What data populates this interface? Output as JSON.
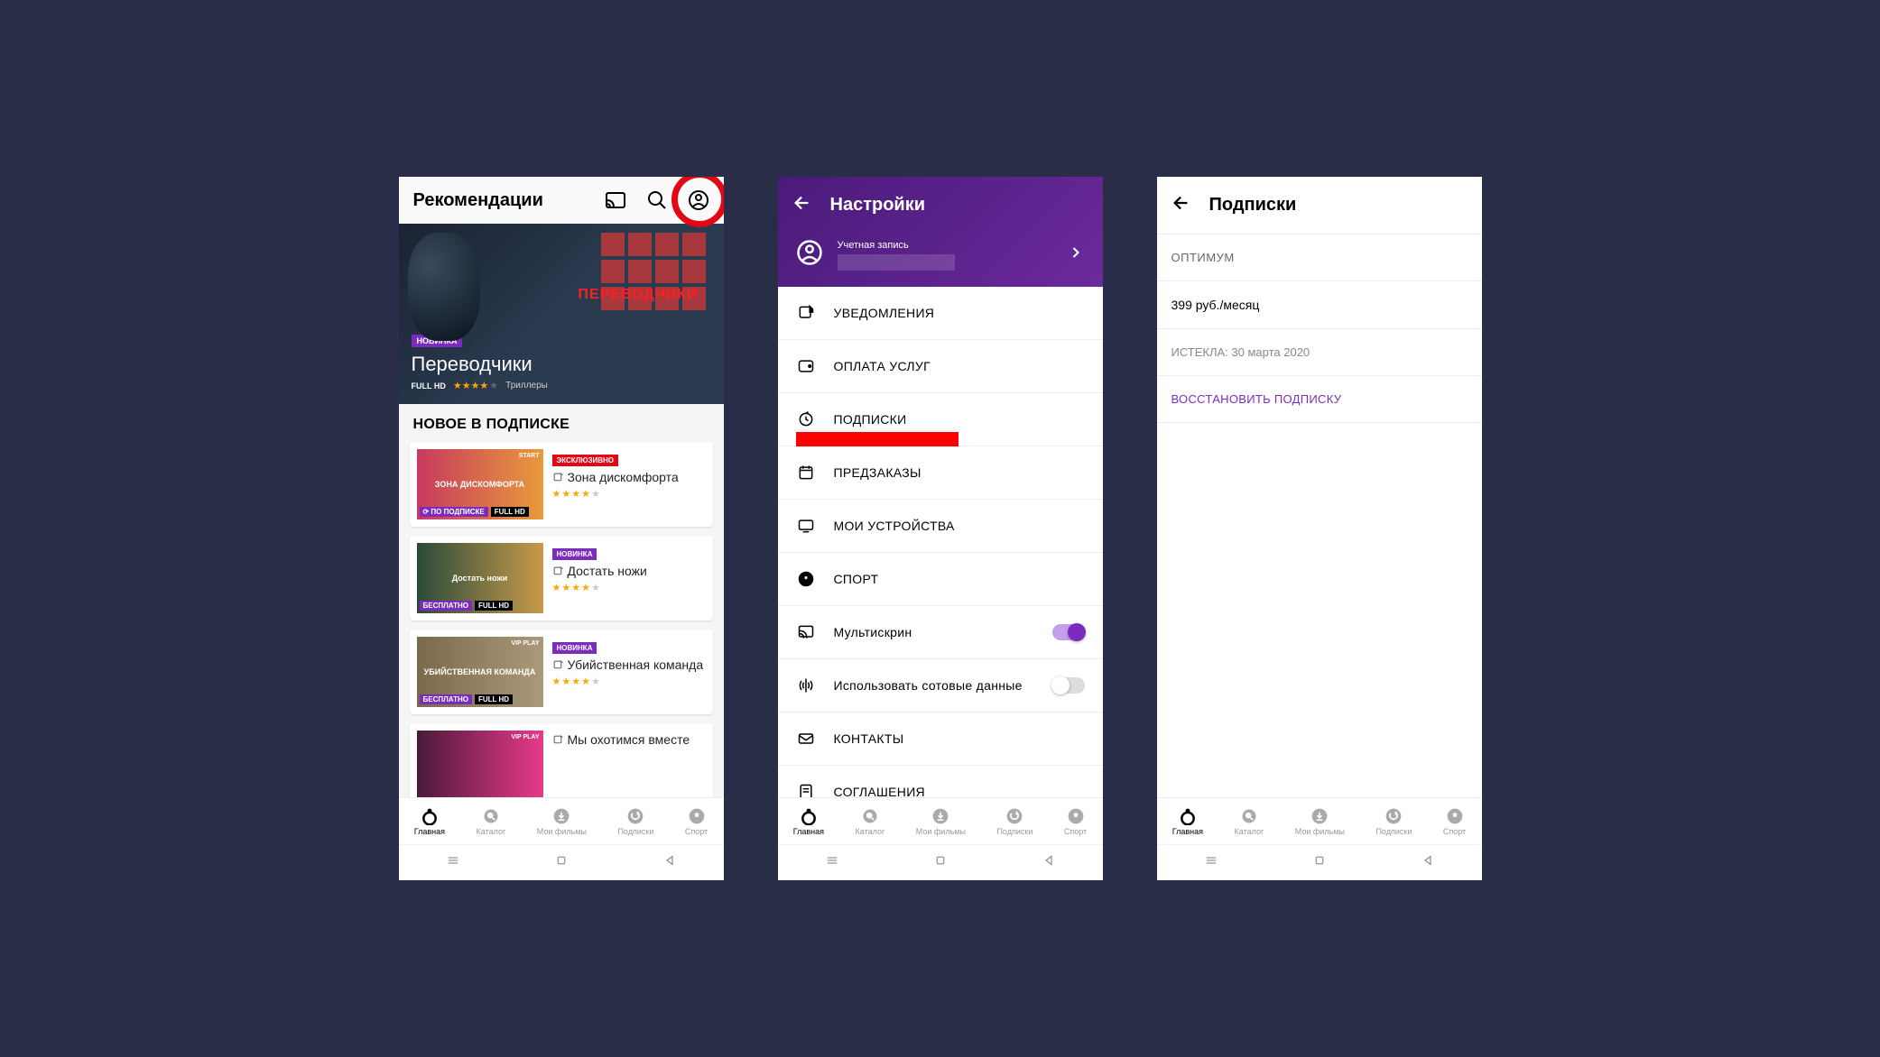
{
  "screen1": {
    "header_title": "Рекомендации",
    "hero": {
      "badge": "НОВИНКА",
      "title": "Переводчики",
      "fullhd": "FULL HD",
      "genre": "Триллеры",
      "brand": "ПЕРЕВОДЧИКИ"
    },
    "section_title": "НОВОЕ В ПОДПИСКЕ",
    "cards": [
      {
        "badge": "ЭКСКЛЮЗИВНО",
        "badge_class": "exc",
        "title": "Зона дискомфорта",
        "stars": 4,
        "tag_brand": "START",
        "tag_left": "ПО ПОДПИСКЕ",
        "tag_left_class": "sub",
        "tag_hd": "FULL HD",
        "img_text": "ЗОНА ДИСКОМФОРТА",
        "img_bg": "linear-gradient(90deg,#c83a5e,#e89a3a)"
      },
      {
        "badge": "НОВИНКА",
        "badge_class": "",
        "title": "Достать ножи",
        "stars": 4.5,
        "tag_brand": "",
        "tag_left": "БЕСПЛАТНО",
        "tag_left_class": "free",
        "tag_hd": "FULL HD",
        "img_text": "Достать ножи",
        "img_bg": "linear-gradient(90deg,#2a4a3a,#c89a4a)"
      },
      {
        "badge": "НОВИНКА",
        "badge_class": "",
        "title": "Убийственная команда",
        "stars": 4,
        "tag_brand": "VIP PLAY",
        "tag_left": "БЕСПЛАТНО",
        "tag_left_class": "free",
        "tag_hd": "FULL HD",
        "img_text": "УБИЙСТВЕННАЯ КОМАНДА",
        "img_bg": "linear-gradient(90deg,#7a6a4a,#aa9a7a)"
      },
      {
        "badge": "",
        "badge_class": "",
        "title": "Мы охотимся вместе",
        "stars": 0,
        "tag_brand": "VIP PLAY",
        "tag_left": "",
        "tag_left_class": "",
        "tag_hd": "",
        "img_text": "",
        "img_bg": "linear-gradient(90deg,#4a1a3a,#e83a8a)"
      }
    ]
  },
  "screen2": {
    "title": "Настройки",
    "account_label": "Учетная запись",
    "items": [
      {
        "label": "УВЕДОМЛЕНИЯ",
        "icon": "bell",
        "highlight": false
      },
      {
        "label": "ОПЛАТА УСЛУГ",
        "icon": "wallet",
        "highlight": false
      },
      {
        "label": "ПОДПИСКИ",
        "icon": "refresh",
        "highlight": true
      },
      {
        "label": "ПРЕДЗАКАЗЫ",
        "icon": "calendar",
        "highlight": false
      },
      {
        "label": "МОИ УСТРОЙСТВА",
        "icon": "monitor",
        "highlight": false
      },
      {
        "label": "СПОРТ",
        "icon": "soccer",
        "highlight": false
      }
    ],
    "toggles": [
      {
        "label": "Мультискрин",
        "icon": "cast",
        "on": true
      },
      {
        "label": "Использовать сотовые данные",
        "icon": "antenna",
        "on": false
      }
    ],
    "tail": [
      {
        "label": "КОНТАКТЫ",
        "icon": "mail"
      },
      {
        "label": "СОГЛАШЕНИЯ",
        "icon": "doc"
      }
    ]
  },
  "screen3": {
    "title": "Подписки",
    "name": "ОПТИМУМ",
    "price": "399 руб./месяц",
    "expired": "ИСТЕКЛА: 30 марта 2020",
    "restore": "ВОССТАНОВИТЬ ПОДПИСКУ"
  },
  "nav": [
    {
      "label": "Главная",
      "icon": "home"
    },
    {
      "label": "Каталог",
      "icon": "search-circle"
    },
    {
      "label": "Мои фильмы",
      "icon": "download"
    },
    {
      "label": "Подписки",
      "icon": "refresh-circle"
    },
    {
      "label": "Спорт",
      "icon": "soccer"
    }
  ]
}
